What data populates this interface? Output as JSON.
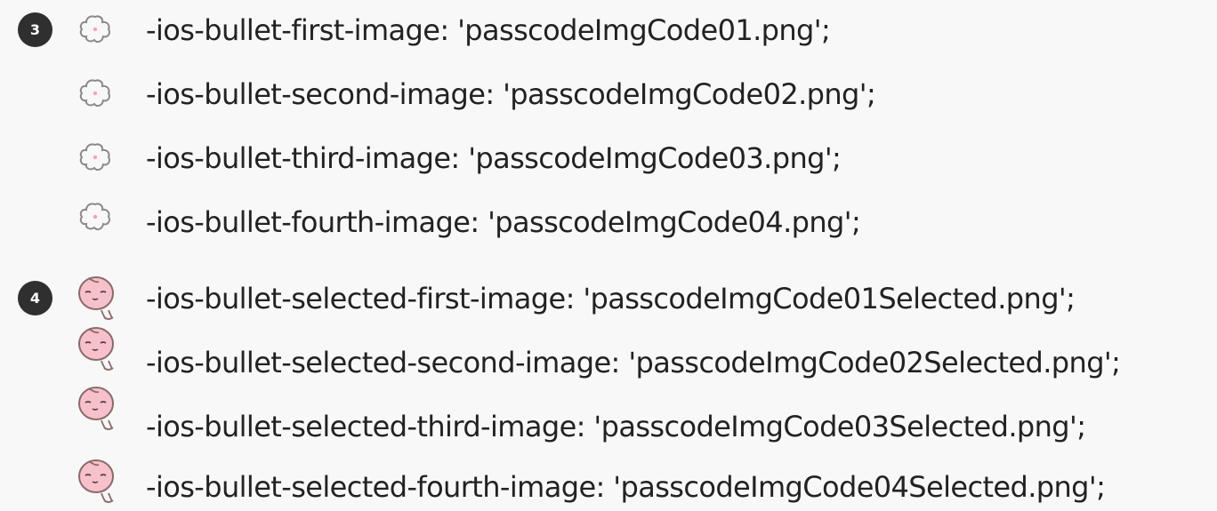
{
  "groups": [
    {
      "step": "3",
      "icon": "flower-outline-icon",
      "lines": [
        "-ios-bullet-first-image: 'passcodeImgCode01.png';",
        "-ios-bullet-second-image: 'passcodeImgCode02.png';",
        "-ios-bullet-third-image: 'passcodeImgCode03.png';",
        "-ios-bullet-fourth-image: 'passcodeImgCode04.png';"
      ]
    },
    {
      "step": "4",
      "icon": "peach-character-icon",
      "lines": [
        "-ios-bullet-selected-first-image: 'passcodeImgCode01Selected.png';",
        "-ios-bullet-selected-second-image: 'passcodeImgCode02Selected.png';",
        "-ios-bullet-selected-third-image: 'passcodeImgCode03Selected.png';",
        "-ios-bullet-selected-fourth-image: 'passcodeImgCode04Selected.png';"
      ]
    }
  ],
  "colors": {
    "background": "#f8f8f8",
    "text": "#222222",
    "badge": "#2f2f2f",
    "flower_stroke": "#8a8a8a",
    "peach_fill": "#f7c1c9",
    "peach_stroke": "#8a6a6a"
  }
}
